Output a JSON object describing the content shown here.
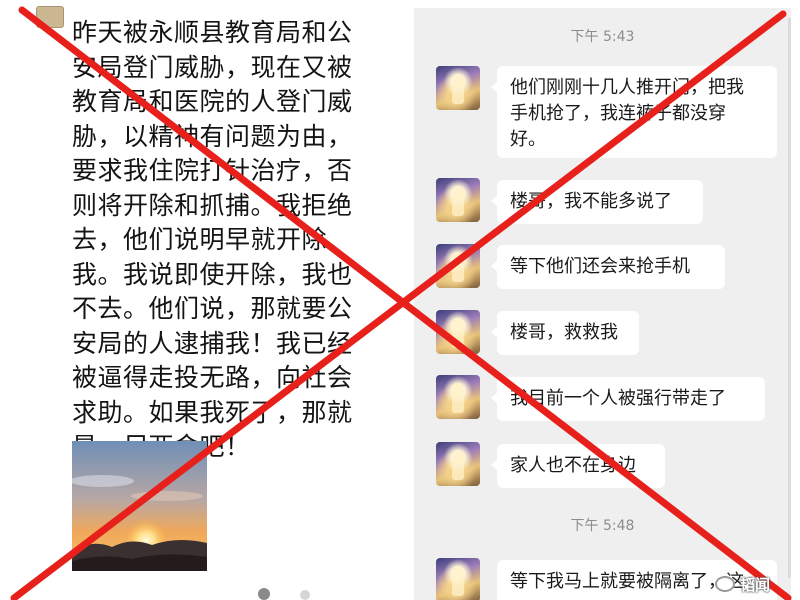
{
  "post": {
    "text": "昨天被永顺县教育局和公\n安局登门威胁，现在又被\n教育局和医院的人登门威\n胁，以精神有问题为由，\n要求我住院打针治疗，否\n则将开除和抓捕。我拒绝\n去，他们说明早就开除\n我。我说即使开除，我也\n不去。他们说，那就要公\n安局的人逮捕我！我已经\n被逼得走投无路，向社会\n求助。如果我死了，那就\n是一尸两命吧！"
  },
  "chat": {
    "time_1": "下午 5:43",
    "time_2": "下午 5:48",
    "messages": [
      {
        "text": "他们刚刚十几人推开门，把我\n手机抢了，我连裤子都没穿\n好。"
      },
      {
        "text": "楼哥，我不能多说了"
      },
      {
        "text": "等下他们还会来抢手机"
      },
      {
        "text": "楼哥，救救我"
      },
      {
        "text": "我目前一个人被强行带走了"
      },
      {
        "text": "家人也不在身边"
      },
      {
        "text": "等下我马上就要被隔离了，这"
      }
    ]
  },
  "watermark": {
    "text": "韬闻"
  },
  "colors": {
    "cross": "#e8201c",
    "chat_background": "#efefef",
    "bubble": "#ffffff"
  }
}
